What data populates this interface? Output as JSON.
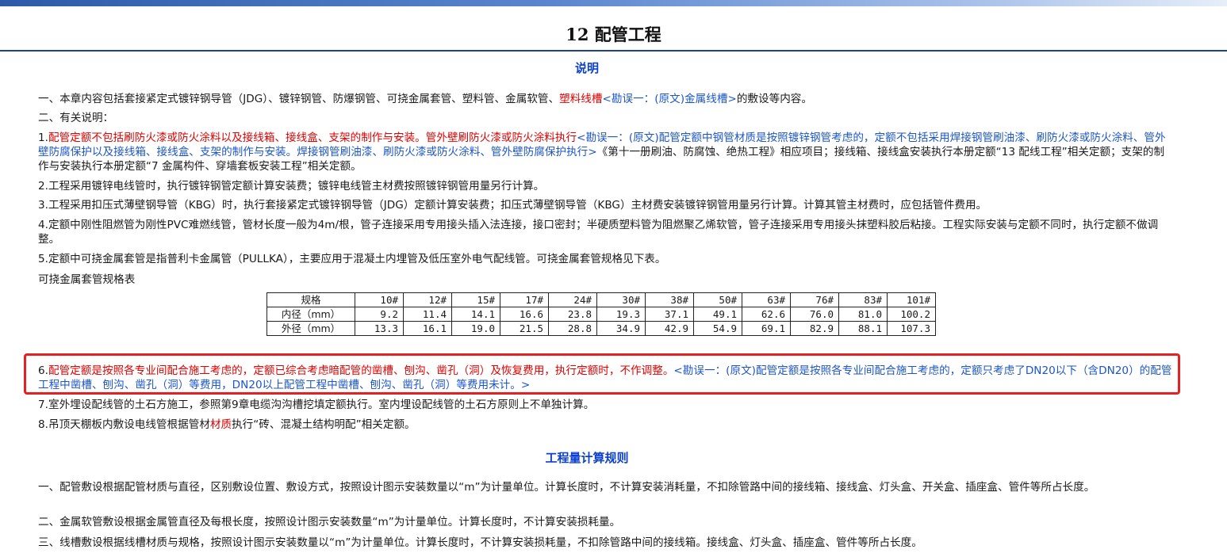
{
  "doc": {
    "title": "12  配管工程",
    "section1_heading": "说明",
    "section2_heading": "工程量计算规则"
  },
  "notes": {
    "p1_a": "一、本章内容包括套接紧定式镀锌钢导管（JDG）、镀锌钢管、防爆钢管、可挠金属套管、塑料管、金属软管、",
    "p1_red": "塑料线槽",
    "p1_blue": "<勘误一：(原文)金属线槽>",
    "p1_b": "的敷设等内容。",
    "p2": "二、有关说明：",
    "i1_prefix": "1.",
    "i1_red": "配管定额不包括刷防火漆或防火涂料以及接线箱、接线盒、支架的制作与安装。管外壁刷防火漆或防火涂料执行",
    "i1_blue": "<勘误一：(原文)配管定额中钢管材质是按照镀锌钢管考虑的，定额不包括采用焊接钢管刷油漆、刷防火漆或防火涂料、管外壁防腐保护以及接线箱、接线盒、支架的制作与安装。焊接钢管刷油漆、刷防火漆或防火涂料、管外壁防腐保护执行>",
    "i1_rest": "《第十一册刷油、防腐蚀、绝热工程》相应项目；接线箱、接线盒安装执行本册定额“13 配线工程”相关定额；支架的制作与安装执行本册定额“7 金属构件、穿墙套板安装工程”相关定额。",
    "i2": "2.工程采用镀锌电线管时，执行镀锌钢管定额计算安装费；镀锌电线管主材费按照镀锌钢管用量另行计算。",
    "i3": "3.工程采用扣压式薄壁钢导管（KBG）时，执行套接紧定式镀锌钢导管（JDG）定额计算安装费；扣压式薄壁钢导管（KBG）主材费安装镀锌钢管用量另行计算。计算其管主材费时，应包括管件费用。",
    "i4": "4.定额中刚性阻燃管为刚性PVC难燃线管，管材长度一般为4m/根，管子连接采用专用接头插入法连接，接口密封；半硬质塑料管为阻燃聚乙烯软管，管子连接采用专用接头抹塑料胶后粘接。工程实际安装与定额不同时，执行定额不做调整。",
    "i5": "5.定额中可挠金属套管是指普利卡金属管（PULLKA），主要应用于混凝土内埋管及低压室外电气配线管。可挠金属套管规格见下表。",
    "table_caption": "可挠金属套管规格表",
    "i6_prefix": "6.",
    "i6_red": "配管定额是按照各专业间配合施工考虑的，定额已综合考虑暗配管的凿槽、刨沟、凿孔（洞）及恢复费用，执行定额时，不作调整。",
    "i6_blue": "<勘误一：(原文)配管定额是按照各专业间配合施工考虑的，定额只考虑了DN20以下（含DN20）的配管工程中凿槽、刨沟、凿孔（洞）等费用，DN20以上配管工程中凿槽、刨沟、凿孔（洞）等费用未计。>",
    "i7": "7.室外埋设配线管的土石方施工，参照第9章电缆沟沟槽挖填定额执行。室内埋设配线管的土石方原则上不单独计算。",
    "i8_a": "8.吊顶天棚板内敷设电线管根据管材",
    "i8_red": "材质",
    "i8_b": "执行“砖、混凝土结构明配”相关定额。"
  },
  "spec_table": {
    "rows": [
      {
        "label": "规格",
        "values": [
          "10#",
          "12#",
          "15#",
          "17#",
          "24#",
          "30#",
          "38#",
          "50#",
          "63#",
          "76#",
          "83#",
          "101#"
        ]
      },
      {
        "label": "内径（mm）",
        "values": [
          "9.2",
          "11.4",
          "14.1",
          "16.6",
          "23.8",
          "19.3",
          "37.1",
          "49.1",
          "62.6",
          "76.0",
          "81.0",
          "100.2"
        ]
      },
      {
        "label": "外径（mm）",
        "values": [
          "13.3",
          "16.1",
          "19.0",
          "21.5",
          "28.8",
          "34.9",
          "42.9",
          "54.9",
          "69.1",
          "82.9",
          "88.1",
          "107.3"
        ]
      }
    ]
  },
  "rules": {
    "r1": "一、配管敷设根据配管材质与直径，区别敷设位置、敷设方式，按照设计图示安装数量以“m”为计量单位。计算长度时，不计算安装消耗量，不扣除管路中间的接线箱、接线盒、灯头盒、开关盒、插座盒、管件等所占长度。",
    "r2": "二、金属软管敷设根据金属管直径及每根长度，按照设计图示安装数量“m”为计量单位。计算长度时，不计算安装损耗量。",
    "r3": "三、线槽敷设根据线槽材质与规格，按照设计图示安装数量以“m”为计量单位。计算长度时，不计算安装损耗量，不扣除管路中间的接线箱。接线盒、灯头盒、插座盒、管件等所占长度。"
  },
  "colors": {
    "heading_blue": "#0b3fd1",
    "errata_blue": "#1c55c9",
    "emphasis_red": "#e00000",
    "highlight_border": "#e52020",
    "title_rule": "#1d3f9a"
  }
}
